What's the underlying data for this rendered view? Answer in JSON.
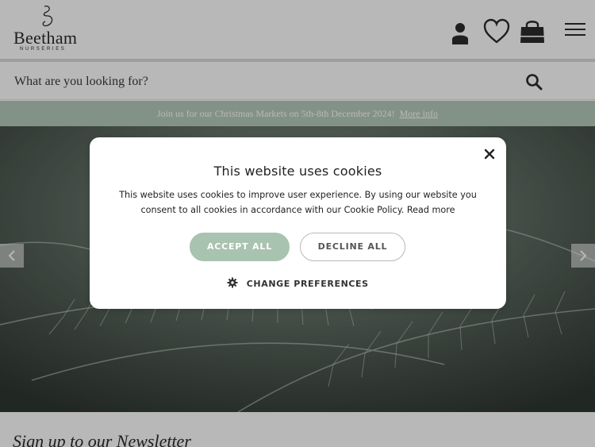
{
  "brand": {
    "name": "Beetham",
    "tagline": "NURSERIES"
  },
  "header": {
    "icons": [
      "account-icon",
      "wishlist-heart-icon",
      "shopping-bag-icon",
      "menu-hamburger-icon"
    ]
  },
  "search": {
    "placeholder": "What are you looking for?"
  },
  "promo": {
    "text": "Join us for our Christmas Markets on 5th-8th December 2024!",
    "link_label": "More info"
  },
  "cookie_dialog": {
    "title": "This website uses cookies",
    "body": "This website uses cookies to improve user experience. By using our website you consent to all cookies in accordance with our Cookie Policy.",
    "read_more": "Read more",
    "accept_label": "ACCEPT ALL",
    "decline_label": "DECLINE ALL",
    "preferences_label": "CHANGE PREFERENCES"
  },
  "newsletter": {
    "heading": "Sign up to our Newsletter"
  },
  "colors": {
    "accent_green": "#a8c3af",
    "promo_bg": "#b6cbbb",
    "text_dark": "#2b2b2b"
  }
}
